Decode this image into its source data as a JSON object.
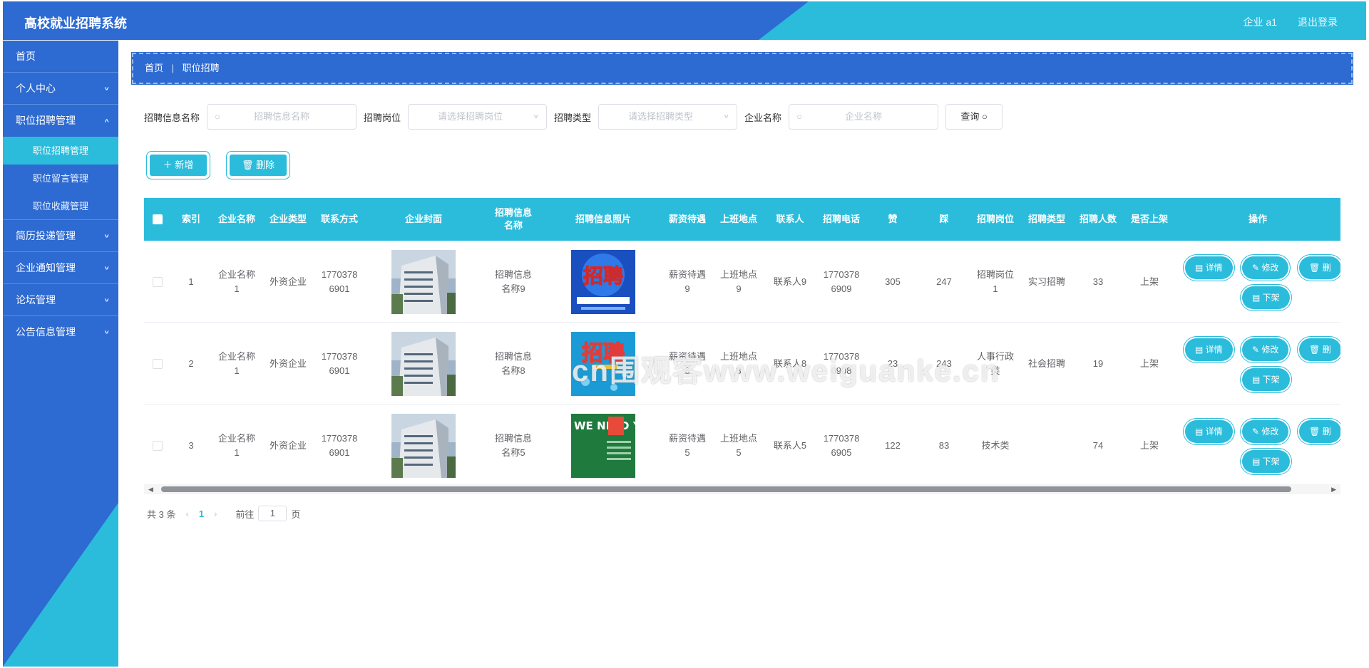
{
  "header": {
    "title": "高校就业招聘系统",
    "user": "企业 a1",
    "logout": "退出登录"
  },
  "sidebar": {
    "items": [
      {
        "label": "首页",
        "chev": ""
      },
      {
        "label": "个人中心",
        "chev": "∨"
      },
      {
        "label": "职位招聘管理",
        "chev": "∨",
        "children": [
          "职位招聘管理",
          "职位留言管理",
          "职位收藏管理"
        ]
      },
      {
        "label": "简历投递管理",
        "chev": "∨"
      },
      {
        "label": "企业通知管理",
        "chev": "∨"
      },
      {
        "label": "论坛管理",
        "chev": "∨"
      },
      {
        "label": "公告信息管理",
        "chev": "∨"
      }
    ]
  },
  "breadcrumb": {
    "home": "首页",
    "sep": "|",
    "current": "职位招聘"
  },
  "filters": {
    "info_label": "招聘信息名称",
    "info_placeholder": "招聘信息名称",
    "post_label": "招聘岗位",
    "post_placeholder": "请选择招聘岗位",
    "type_label": "招聘类型",
    "type_placeholder": "请选择招聘类型",
    "company_label": "企业名称",
    "company_placeholder": "企业名称",
    "query": "查询 ○"
  },
  "toolbar": {
    "add": "＋ 新增",
    "delete": "🗑 删除"
  },
  "table": {
    "headers": [
      "索引",
      "企业名称",
      "企业类型",
      "联系方式",
      "企业封面",
      "招聘信息\n名称",
      "招聘信息照片",
      "薪资待遇",
      "上班地点",
      "联系人",
      "招聘电话",
      "赞",
      "踩",
      "招聘岗位",
      "招聘类型",
      "招聘人数",
      "是否上架",
      "操作"
    ],
    "rows": [
      {
        "index": "1",
        "company": "企业名称\n1",
        "type": "外资企业",
        "phone": "1770378\n6901",
        "name": "招聘信息\n名称9",
        "salary": "薪资待遇\n9",
        "location": "上班地点\n9",
        "contact": "联系人9",
        "tel": "1770378\n6909",
        "like": "305",
        "dislike": "247",
        "post": "招聘岗位\n1",
        "rtype": "实习招聘",
        "count": "33",
        "shelf": "上架",
        "poster": "blue"
      },
      {
        "index": "2",
        "company": "企业名称\n1",
        "type": "外资企业",
        "phone": "1770378\n6901",
        "name": "招聘信息\n名称8",
        "salary": "薪资待遇\n8",
        "location": "上班地点\n8",
        "contact": "联系人8",
        "tel": "1770378\n6908",
        "like": "23",
        "dislike": "243",
        "post": "人事行政\n类",
        "rtype": "社会招聘",
        "count": "19",
        "shelf": "上架",
        "poster": "cyan"
      },
      {
        "index": "3",
        "company": "企业名称\n1",
        "type": "外资企业",
        "phone": "1770378\n6901",
        "name": "招聘信息\n名称5",
        "salary": "薪资待遇\n5",
        "location": "上班地点\n5",
        "contact": "联系人5",
        "tel": "1770378\n6905",
        "like": "122",
        "dislike": "83",
        "post": "技术类",
        "rtype": "",
        "count": "74",
        "shelf": "上架",
        "poster": "green"
      }
    ],
    "ops": {
      "detail": "详情",
      "edit": "修改",
      "delete": "删",
      "offshelf": "下架"
    }
  },
  "poster_text": {
    "blue_main": "招聘",
    "cyan_main": "招聘",
    "green_main": "WE NEED YOU 聘"
  },
  "pager": {
    "total": "共 3 条",
    "page": "1",
    "goto": "前往",
    "page_input": "1",
    "page_suffix": "页"
  },
  "watermark": "cn围观客www.weiguanke.cn",
  "colors": {
    "primary": "#2d6ad1",
    "accent": "#2bbcdc"
  }
}
